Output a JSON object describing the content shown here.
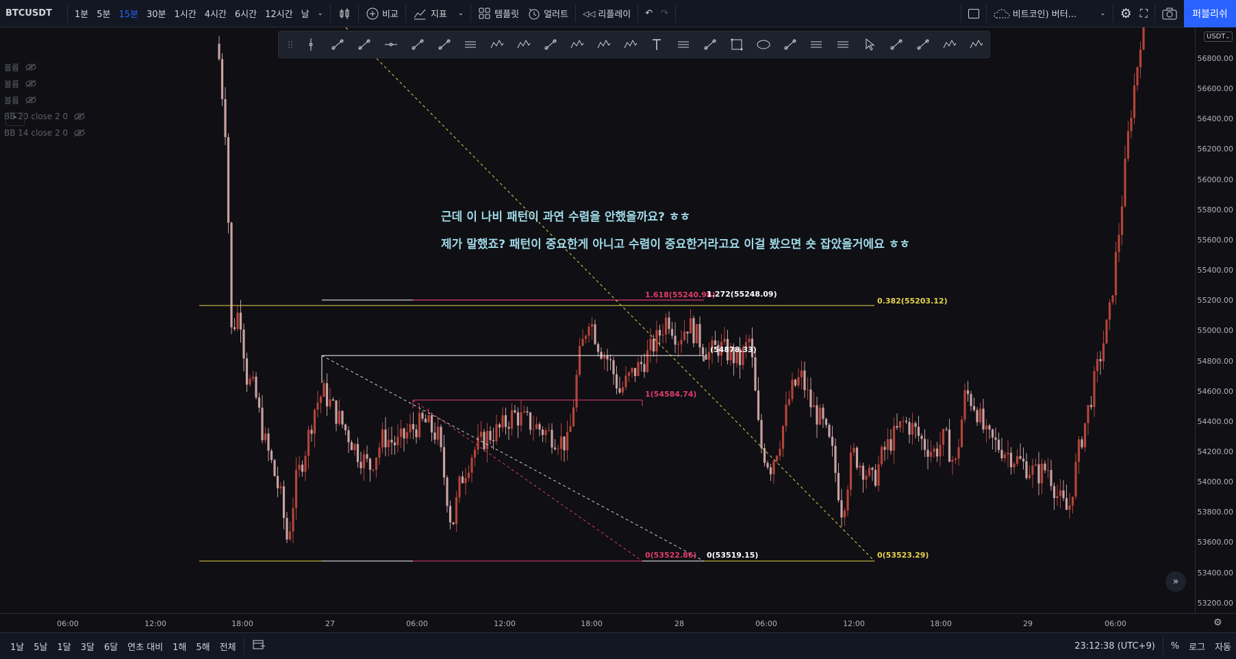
{
  "topbar": {
    "symbol": "BTCUSDT",
    "intervals": [
      {
        "label": "1분"
      },
      {
        "label": "5분"
      },
      {
        "label": "15분"
      },
      {
        "label": "30분"
      },
      {
        "label": "1시간"
      },
      {
        "label": "4시간"
      },
      {
        "label": "6시간"
      },
      {
        "label": "12시간"
      },
      {
        "label": "날"
      }
    ],
    "active_interval": "15분",
    "compare": "비교",
    "indicators": "지표",
    "templates": "템플릿",
    "alert": "얼러트",
    "replay": "리플레이",
    "layout_name": "비트코인) 버터...",
    "publish": "퍼블리쉬"
  },
  "legend": [
    {
      "label": "볼륨"
    },
    {
      "label": "볼륨"
    },
    {
      "label": "볼륨"
    },
    {
      "label": "BB 20 close 2 0"
    },
    {
      "label": "BB 14 close 2 0"
    }
  ],
  "annotations": [
    "근데 이 나비 패턴이 과연 수렴을 안했을까요? ㅎㅎ",
    "제가 말했죠? 패턴이 중요한게 아니고 수렴이 중요한거라고요 이걸 봤으면 숏 잡았을거에요 ㅎㅎ"
  ],
  "fib_labels": {
    "red_1618": "1.618(55240.98)",
    "white_1272": "1.272(55248.09)",
    "yellow_0382": "0.382(55203.12)",
    "white_mid": "(54878.33)",
    "red_1": "1(54584.74)",
    "red_0": "0(53522.86)",
    "white_0": "0(53519.15)",
    "yellow_0": "0(53523.29)"
  },
  "price_axis": {
    "currency": "USDT",
    "labels": [
      "56800.00",
      "56600.00",
      "56400.00",
      "56200.00",
      "56000.00",
      "55800.00",
      "55600.00",
      "55400.00",
      "55200.00",
      "55000.00",
      "54800.00",
      "54600.00",
      "54400.00",
      "54200.00",
      "54000.00",
      "53800.00",
      "53600.00",
      "53400.00",
      "53200.00"
    ]
  },
  "time_axis": {
    "labels": [
      "06:00",
      "12:00",
      "18:00",
      "27",
      "06:00",
      "12:00",
      "18:00",
      "28",
      "06:00",
      "12:00",
      "18:00",
      "29",
      "06:00"
    ]
  },
  "bottombar": {
    "ranges": [
      {
        "label": "1날"
      },
      {
        "label": "5날"
      },
      {
        "label": "1달"
      },
      {
        "label": "3달"
      },
      {
        "label": "6달"
      },
      {
        "label": "연초 대비"
      },
      {
        "label": "1해"
      },
      {
        "label": "5해"
      },
      {
        "label": "전체"
      }
    ],
    "clock": "23:12:38 (UTC+9)",
    "percent": "%",
    "log": "로그",
    "auto": "자동"
  },
  "colors": {
    "up": "#b5443a",
    "down": "#c9a2a2",
    "fib_yellow": "#e8d44d",
    "fib_red": "#e03c6a",
    "accent": "#2962ff"
  }
}
